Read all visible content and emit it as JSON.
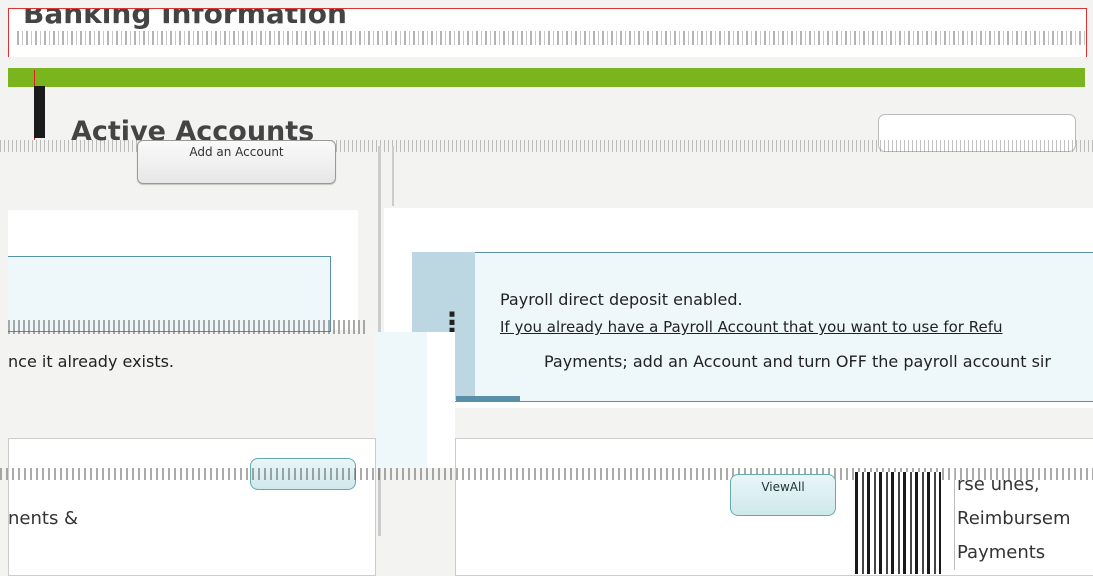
{
  "header": {
    "title": "Banking Information"
  },
  "section": {
    "heading": "Active Accounts"
  },
  "buttons": {
    "add_account": "Add an Account",
    "view_all": "ViewAll"
  },
  "left_card": {
    "message": "nce it already exists.",
    "list_text": "nents &"
  },
  "right_card": {
    "line1": "Payroll direct deposit enabled.",
    "line2": "If you already have a Payroll Account that you want to use for Refu",
    "line3": "Payments; add an Account and turn OFF the payroll account sir"
  },
  "bottom_right": {
    "items": [
      "rse unes,",
      "Reimbursem",
      "Payments"
    ]
  },
  "colors": {
    "accent_green": "#7ab51d",
    "info_bg": "#eef8fb",
    "info_border": "#5a8fa8",
    "header_border": "#dd3333"
  },
  "icons": {
    "info": "info-icon"
  }
}
